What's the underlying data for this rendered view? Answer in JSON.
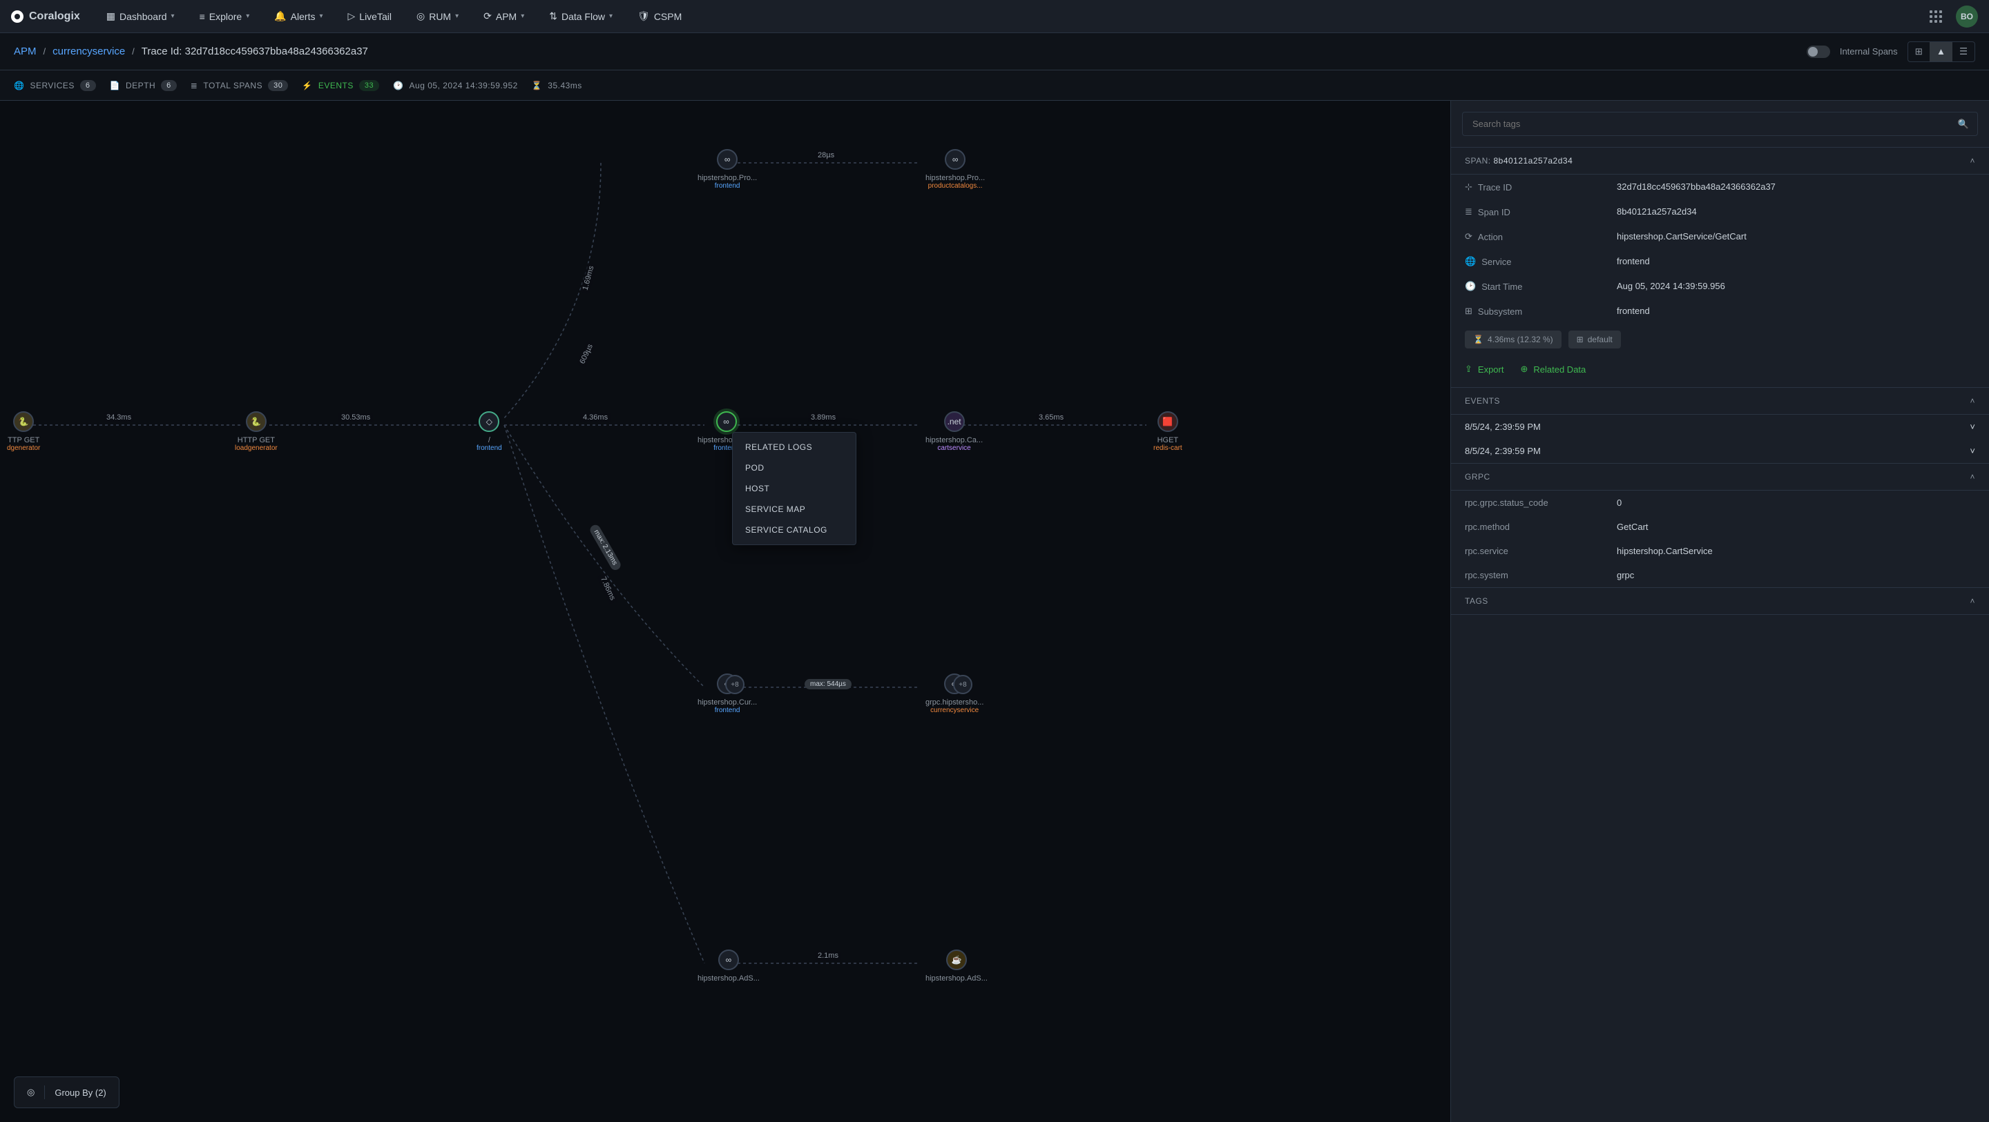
{
  "brand": "Coralogix",
  "nav": {
    "items": [
      {
        "label": "Dashboard",
        "hasCaret": true,
        "icon": "dashboard-icon"
      },
      {
        "label": "Explore",
        "hasCaret": true,
        "icon": "explore-icon"
      },
      {
        "label": "Alerts",
        "hasCaret": true,
        "icon": "alerts-icon"
      },
      {
        "label": "LiveTail",
        "hasCaret": false,
        "icon": "livetail-icon"
      },
      {
        "label": "RUM",
        "hasCaret": true,
        "icon": "rum-icon"
      },
      {
        "label": "APM",
        "hasCaret": true,
        "icon": "apm-icon"
      },
      {
        "label": "Data Flow",
        "hasCaret": true,
        "icon": "dataflow-icon"
      },
      {
        "label": "CSPM",
        "hasCaret": false,
        "icon": "cspm-icon"
      }
    ],
    "avatar": "BO"
  },
  "breadcrumb": {
    "apm": "APM",
    "service": "currencyservice",
    "trace_prefix": "Trace Id: ",
    "trace_id": "32d7d18cc459637bba48a24366362a37",
    "internal_spans": "Internal Spans"
  },
  "stats": {
    "services": {
      "label": "SERVICES",
      "value": "6"
    },
    "depth": {
      "label": "DEPTH",
      "value": "6"
    },
    "total_spans": {
      "label": "TOTAL SPANS",
      "value": "30"
    },
    "events": {
      "label": "EVENTS",
      "value": "33"
    },
    "timestamp": "Aug 05, 2024 14:39:59.952",
    "duration": "35.43ms"
  },
  "graph": {
    "nodes": {
      "ttpget": {
        "name": "TTP GET",
        "svc": "dgenerator",
        "svcClass": "orange"
      },
      "httpget": {
        "name": "HTTP GET",
        "svc": "loadgenerator",
        "svcClass": "orange"
      },
      "slash": {
        "name": "/",
        "svc": "frontend",
        "svcClass": ""
      },
      "cartget": {
        "name": "hipstershop.Ca...",
        "svc": "frontend",
        "svcClass": ""
      },
      "cartsvc": {
        "name": "hipstershop.Ca...",
        "svc": "cartservice",
        "svcClass": "purple"
      },
      "hget": {
        "name": "HGET",
        "svc": "redis-cart",
        "svcClass": "orange"
      },
      "prod1": {
        "name": "hipstershop.Pro...",
        "svc": "frontend",
        "svcClass": ""
      },
      "prod2": {
        "name": "hipstershop.Pro...",
        "svc": "productcatalogs...",
        "svcClass": "orange"
      },
      "cur": {
        "name": "hipstershop.Cur...",
        "svc": "frontend",
        "svcClass": ""
      },
      "grpccur": {
        "name": "grpc.hipstersho...",
        "svc": "currencyservice",
        "svcClass": "orange"
      },
      "ads1": {
        "name": "hipstershop.AdS...",
        "svc": "",
        "svcClass": ""
      },
      "ads2": {
        "name": "hipstershop.AdS...",
        "svc": "",
        "svcClass": ""
      }
    },
    "edges": {
      "e1": "34.3ms",
      "e2": "30.53ms",
      "e3": "4.36ms",
      "e4": "3.89ms",
      "e5": "3.65ms",
      "e6": "1.69ms",
      "e7": "28µs",
      "e8": "609µs",
      "e9": "7.86ms",
      "e10": "2.1ms",
      "maxpill": "max: 544µs",
      "curve_badge": "max: 2.13ms"
    },
    "plus8": "+8"
  },
  "contextMenu": {
    "items": [
      "RELATED LOGS",
      "POD",
      "HOST",
      "SERVICE MAP",
      "SERVICE CATALOG"
    ]
  },
  "groupBy": {
    "label": "Group By (2)"
  },
  "side": {
    "search_placeholder": "Search tags",
    "span_header_prefix": "SPAN: ",
    "span_header_id": "8b40121a257a2d34",
    "kv": [
      {
        "k": "Trace ID",
        "v": "32d7d18cc459637bba48a24366362a37",
        "icon": "trace-icon"
      },
      {
        "k": "Span ID",
        "v": "8b40121a257a2d34",
        "icon": "span-icon"
      },
      {
        "k": "Action",
        "v": "hipstershop.CartService/GetCart",
        "icon": "action-icon"
      },
      {
        "k": "Service",
        "v": "frontend",
        "icon": "service-icon"
      },
      {
        "k": "Start Time",
        "v": "Aug 05, 2024 14:39:59.956",
        "icon": "clock-icon"
      },
      {
        "k": "Subsystem",
        "v": "frontend",
        "icon": "subsystem-icon"
      }
    ],
    "chips": {
      "dur": "4.36ms (12.32 %)",
      "grp": "default"
    },
    "actions": {
      "export": "Export",
      "related": "Related Data"
    },
    "events": {
      "header": "EVENTS",
      "rows": [
        "8/5/24, 2:39:59 PM",
        "8/5/24, 2:39:59 PM"
      ]
    },
    "grpc": {
      "header": "GRPC",
      "rows": [
        {
          "k": "rpc.grpc.status_code",
          "v": "0"
        },
        {
          "k": "rpc.method",
          "v": "GetCart"
        },
        {
          "k": "rpc.service",
          "v": "hipstershop.CartService"
        },
        {
          "k": "rpc.system",
          "v": "grpc"
        }
      ]
    },
    "tags_header": "TAGS"
  }
}
